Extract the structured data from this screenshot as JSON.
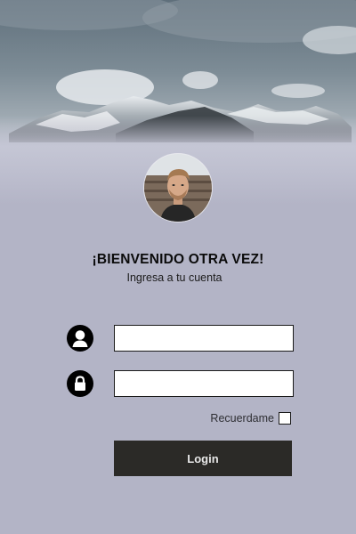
{
  "header": {
    "title": "¡BIENVENIDO OTRA VEZ!",
    "subtitle": "Ingresa a tu cuenta"
  },
  "form": {
    "username_icon": "user-icon",
    "username_value": "",
    "password_icon": "lock-icon",
    "password_value": "",
    "remember_label": "Recuerdame",
    "remember_checked": false,
    "login_label": "Login"
  },
  "colors": {
    "background": "#b3b4c6",
    "button": "#2b2a27",
    "button_text": "#e8e8e8",
    "icon": "#000000"
  }
}
